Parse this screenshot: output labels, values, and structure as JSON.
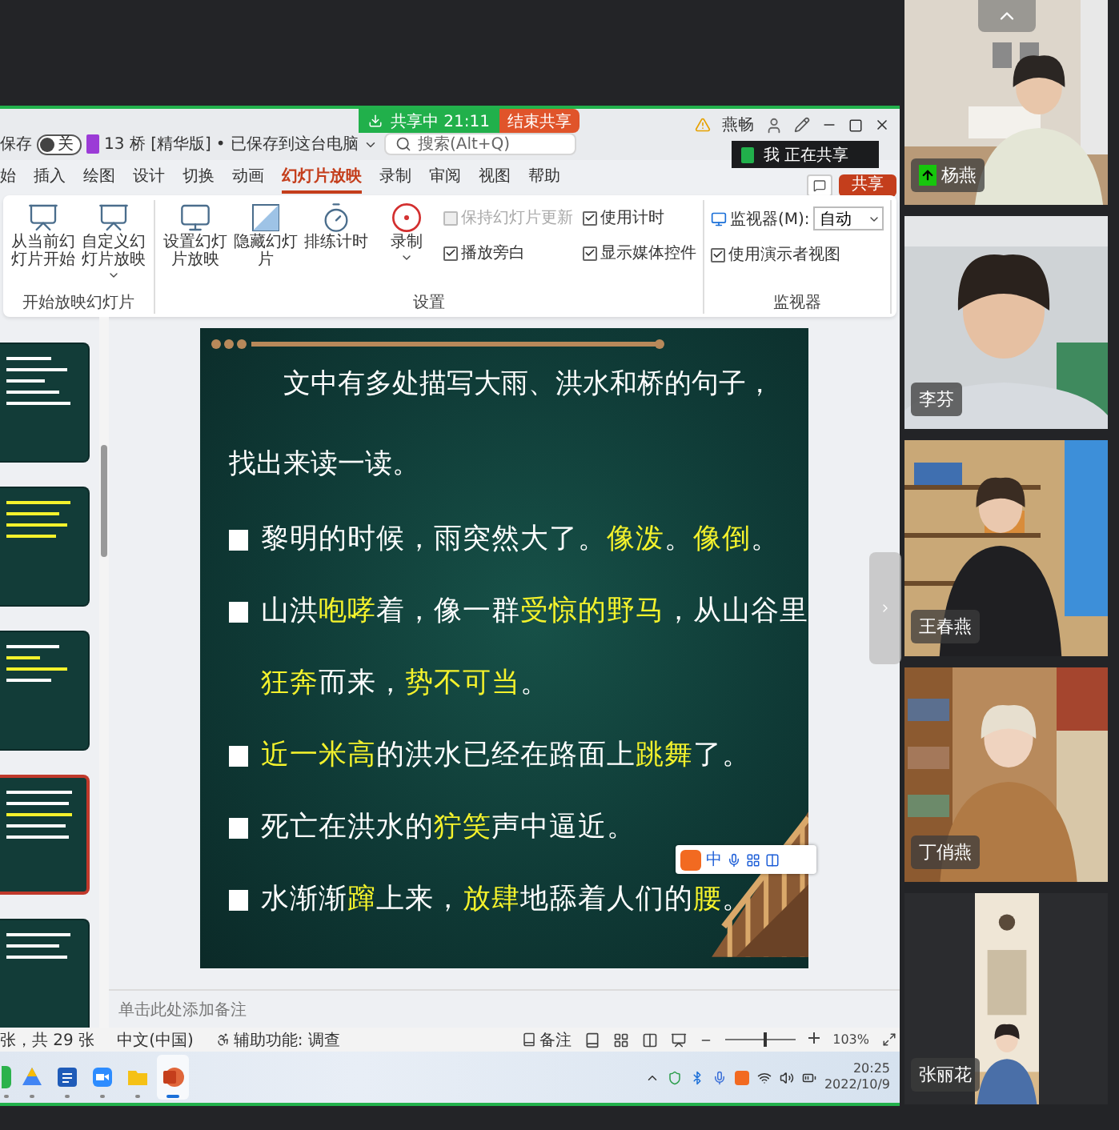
{
  "title_bar": {
    "autosave_label": "保存",
    "autosave_state": "关",
    "autosave_on": false,
    "document_title": "13 桥 [精华版]",
    "save_status": "• 已保存到这台电脑",
    "search_placeholder": "搜索(Alt+Q)",
    "user_name": "燕畅"
  },
  "share_bar": {
    "status": "共享中 21:11",
    "stop_button": "结束共享"
  },
  "share_tooltip": "我 正在共享",
  "share_button": "共享",
  "tabs": [
    {
      "label": "始",
      "selected": false
    },
    {
      "label": "插入",
      "selected": false
    },
    {
      "label": "绘图",
      "selected": false
    },
    {
      "label": "设计",
      "selected": false
    },
    {
      "label": "切换",
      "selected": false
    },
    {
      "label": "动画",
      "selected": false
    },
    {
      "label": "幻灯片放映",
      "selected": true
    },
    {
      "label": "录制",
      "selected": false
    },
    {
      "label": "审阅",
      "selected": false
    },
    {
      "label": "视图",
      "selected": false
    },
    {
      "label": "帮助",
      "selected": false
    }
  ],
  "ribbon_groups": [
    {
      "label": "开始放映幻灯片",
      "items": [
        {
          "kind": "large",
          "label": "从当前幻灯片开始",
          "dropdown": false
        },
        {
          "kind": "large",
          "label": "自定义幻灯片放映",
          "dropdown": true
        }
      ]
    },
    {
      "label": "设置",
      "items": [
        {
          "kind": "large",
          "label": "设置幻灯片放映",
          "dropdown": false
        },
        {
          "kind": "large",
          "label": "隐藏幻灯片",
          "dropdown": false
        },
        {
          "kind": "large",
          "label": "排练计时",
          "dropdown": false
        },
        {
          "kind": "large",
          "label": "录制",
          "dropdown": true
        },
        {
          "kind": "checkbox",
          "label": "保持幻灯片更新",
          "checked": false,
          "disabled": true
        },
        {
          "kind": "checkbox",
          "label": "播放旁白",
          "checked": true,
          "disabled": false
        },
        {
          "kind": "checkbox",
          "label": "使用计时",
          "checked": true,
          "disabled": false
        },
        {
          "kind": "checkbox",
          "label": "显示媒体控件",
          "checked": true,
          "disabled": false
        }
      ]
    },
    {
      "label": "监视器",
      "items": [
        {
          "kind": "select",
          "label": "监视器(M):",
          "value": "自动"
        },
        {
          "kind": "checkbox",
          "label": "使用演示者视图",
          "checked": true,
          "disabled": false
        }
      ]
    }
  ],
  "slide_thumbnails": [
    {
      "selected": false
    },
    {
      "selected": false
    },
    {
      "selected": false
    },
    {
      "selected": true
    },
    {
      "selected": false
    }
  ],
  "slide": {
    "title_lines": [
      "文中有多处描写大雨、洪水和桥的句子，",
      "找出来读一读。"
    ],
    "bullets": [
      {
        "lines": [
          [
            {
              "text": "黎明的时候，雨突然大了。",
              "highlight": false
            },
            {
              "text": "像泼",
              "highlight": true
            },
            {
              "text": "。",
              "highlight": false
            },
            {
              "text": "像倒",
              "highlight": true
            },
            {
              "text": "。",
              "highlight": false
            }
          ]
        ]
      },
      {
        "lines": [
          [
            {
              "text": "山洪",
              "highlight": false
            },
            {
              "text": "咆哮",
              "highlight": true
            },
            {
              "text": "着，像一群",
              "highlight": false
            },
            {
              "text": "受惊的野马",
              "highlight": true
            },
            {
              "text": "，从山谷里",
              "highlight": false
            }
          ],
          [
            {
              "text": "狂奔",
              "highlight": true
            },
            {
              "text": "而来，",
              "highlight": false
            },
            {
              "text": "势不可当",
              "highlight": true
            },
            {
              "text": "。",
              "highlight": false
            }
          ]
        ]
      },
      {
        "lines": [
          [
            {
              "text": "近一米高",
              "highlight": true
            },
            {
              "text": "的洪水已经在路面上",
              "highlight": false
            },
            {
              "text": "跳舞",
              "highlight": true
            },
            {
              "text": "了。",
              "highlight": false
            }
          ]
        ]
      },
      {
        "lines": [
          [
            {
              "text": "死亡在洪水的",
              "highlight": false
            },
            {
              "text": "狞笑",
              "highlight": true
            },
            {
              "text": "声中逼近。",
              "highlight": false
            }
          ]
        ]
      },
      {
        "lines": [
          [
            {
              "text": "水渐渐",
              "highlight": false
            },
            {
              "text": "蹿",
              "highlight": true
            },
            {
              "text": "上来，",
              "highlight": false
            },
            {
              "text": "放肆",
              "highlight": true
            },
            {
              "text": "地舔着人们的",
              "highlight": false
            },
            {
              "text": "腰",
              "highlight": true
            },
            {
              "text": "。",
              "highlight": false
            }
          ]
        ]
      }
    ]
  },
  "ime_toolbar": {
    "mode": "中"
  },
  "notes_placeholder": "单击此处添加备注",
  "status_bar": {
    "slide_info": "张，共 29 张",
    "language": "中文(中国)",
    "accessibility": "辅助功能: 调查",
    "notes_button": "备注",
    "zoom": {
      "level": 0.55,
      "reading": "103%"
    }
  },
  "taskbar": {
    "apps": [
      {
        "active": false
      },
      {
        "active": false
      },
      {
        "active": false
      },
      {
        "active": false
      },
      {
        "active": false
      },
      {
        "active": true
      }
    ],
    "time": "20:25",
    "date": "2022/10/9"
  },
  "participants": [
    {
      "name": "杨燕",
      "speaking": true,
      "kind": "full"
    },
    {
      "name": "李芬",
      "speaking": false,
      "kind": "full"
    },
    {
      "name": "王春燕",
      "speaking": false,
      "kind": "full"
    },
    {
      "name": "丁俏燕",
      "speaking": false,
      "kind": "full"
    },
    {
      "name": "张丽花",
      "speaking": false,
      "kind": "portrait"
    }
  ]
}
